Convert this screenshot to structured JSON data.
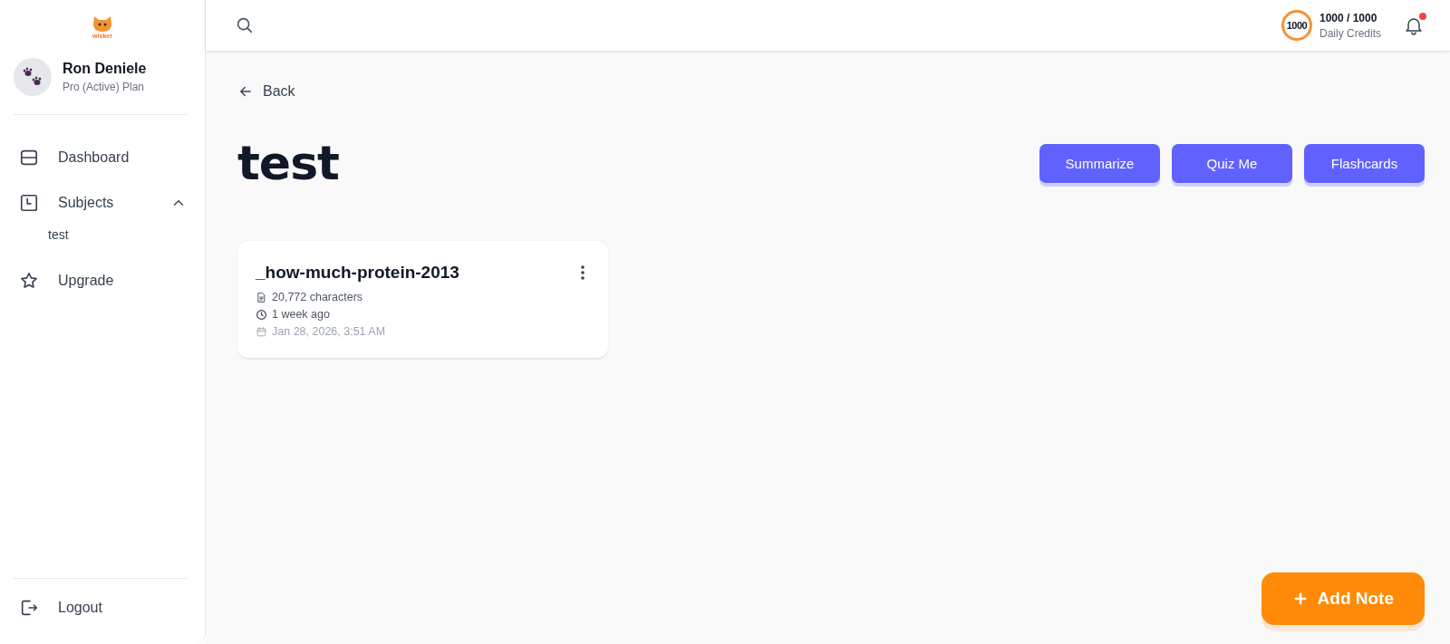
{
  "logo": {
    "text": "wisker"
  },
  "user": {
    "name": "Ron Deniele",
    "plan": "Pro (Active) Plan"
  },
  "nav": [
    {
      "kind": "dashboard",
      "label": "Dashboard"
    },
    {
      "kind": "subjects",
      "label": "Subjects",
      "expanded": true,
      "children": [
        {
          "label": "test"
        }
      ]
    },
    {
      "kind": "upgrade",
      "label": "Upgrade"
    }
  ],
  "logout": {
    "label": "Logout"
  },
  "topbar": {
    "credits_badge": "1000",
    "credits": "1000 / 1000",
    "credits_label": "Daily Credits",
    "unread": true
  },
  "back": {
    "label": "Back"
  },
  "page_title": "test",
  "actions": [
    "Summarize",
    "Quiz Me",
    "Flashcards"
  ],
  "notes": [
    {
      "title": "_how-much-protein-2013",
      "characters": "20,772 characters",
      "ago": "1 week ago",
      "date": "Jan 28, 2026, 3:51 AM"
    }
  ],
  "add_button": {
    "label": "Add Note"
  }
}
